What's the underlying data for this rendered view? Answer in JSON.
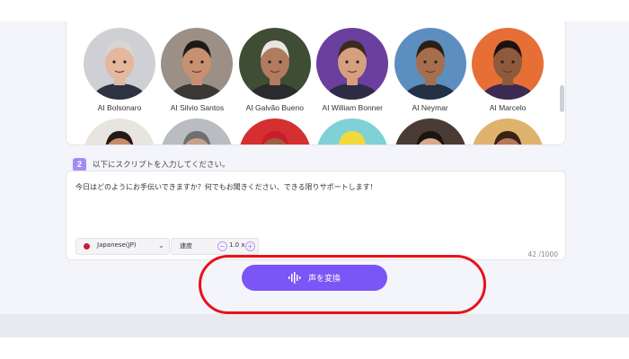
{
  "voices": [
    {
      "name": "AI Bolsonaro",
      "skin": "#e3b89c",
      "hair": "#d8d6d2",
      "bg": "#cfcfd6",
      "shirt": "#2e3341"
    },
    {
      "name": "AI Silvio Santos",
      "skin": "#c79071",
      "hair": "#1c1a19",
      "bg": "#9b8f86",
      "shirt": "#3a3734"
    },
    {
      "name": "AI Galvão Bueno",
      "skin": "#b07b5e",
      "hair": "#e9e6e2",
      "bg": "#3f4d34",
      "shirt": "#2a2b2e"
    },
    {
      "name": "AI William Bonner",
      "skin": "#d6a07e",
      "hair": "#3d2a20",
      "bg": "#6a3f9e",
      "shirt": "#2c2c44"
    },
    {
      "name": "AI Neymar",
      "skin": "#a66e4c",
      "hair": "#2c1f17",
      "bg": "#5c8fc0",
      "shirt": "#223044"
    },
    {
      "name": "AI Marcelo",
      "skin": "#8d5a3c",
      "hair": "#1b1310",
      "bg": "#e76e35",
      "shirt": "#3b2a52"
    },
    {
      "name": "",
      "skin": "#c58b6a",
      "hair": "#241914",
      "bg": "#e8e4df",
      "shirt": "#ffffff"
    },
    {
      "name": "",
      "skin": "#c7a08b",
      "hair": "#6f6f6f",
      "bg": "#b9bcc0",
      "shirt": "#ffffff"
    },
    {
      "name": "",
      "skin": "#a35c3f",
      "hair": "#c81e2c",
      "bg": "#d53030",
      "shirt": "#ffffff"
    },
    {
      "name": "",
      "skin": "#f2d93c",
      "hair": "#f2d93c",
      "bg": "#7fd1d6",
      "shirt": "#ffffff"
    },
    {
      "name": "",
      "skin": "#d9a98a",
      "hair": "#1a1412",
      "bg": "#4a3c34",
      "shirt": "#ffffff"
    },
    {
      "name": "",
      "skin": "#b9785a",
      "hair": "#3a2216",
      "bg": "#dfb36d",
      "shirt": "#ffffff"
    }
  ],
  "step": {
    "number": "2",
    "label": "以下にスクリプトを入力してください。"
  },
  "script": {
    "text": "今日はどのようにお手伝いできますか？何でもお聞きください、できる限りサポートします！",
    "char_count": "42 /1000"
  },
  "language": {
    "selected": "Japanese(JP)",
    "flag_color": "#c51d36"
  },
  "speed": {
    "label": "速度",
    "value": "1.0 x"
  },
  "convert_button": {
    "label": "声を変換"
  },
  "colors": {
    "accent": "#7b55f5",
    "step_badge": "#a78bf5",
    "highlight": "#e8121a",
    "background": "#f4f5fb"
  }
}
